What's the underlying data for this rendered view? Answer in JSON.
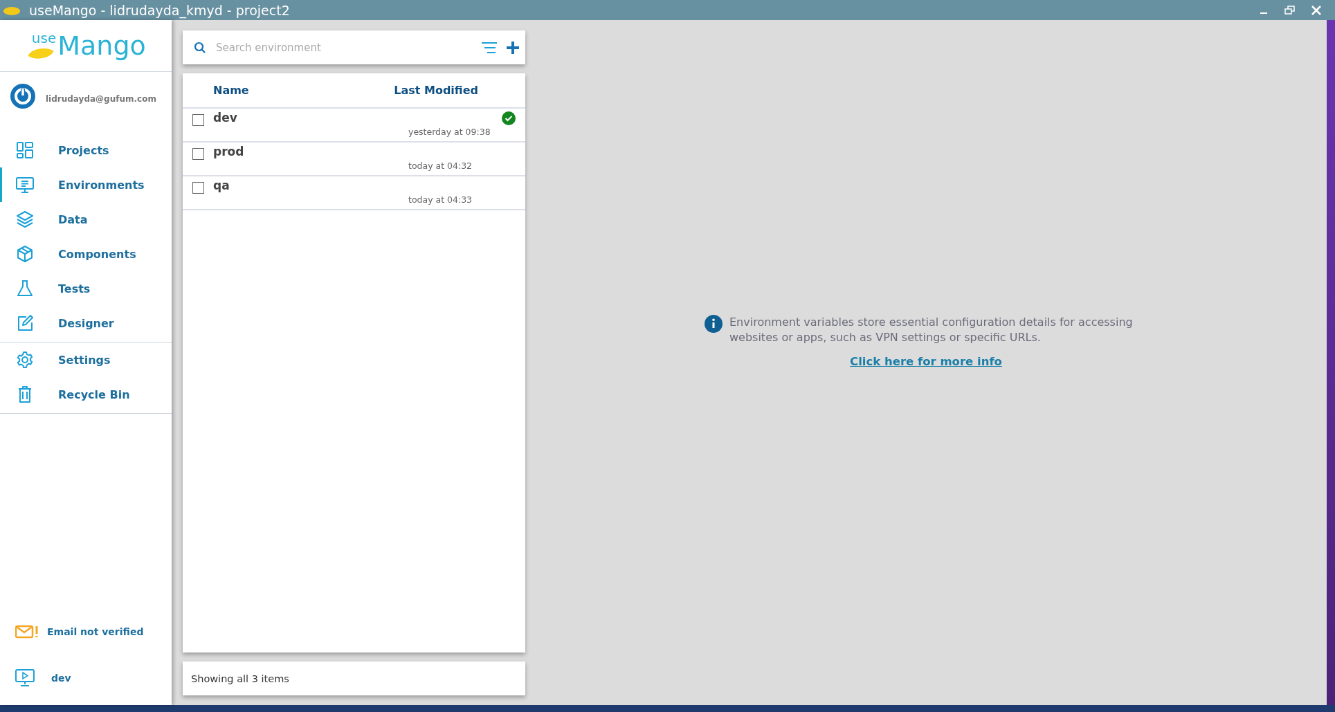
{
  "window": {
    "title": "useMango - lidrudayda_kmyd - project2"
  },
  "sidebar": {
    "logo": {
      "prefix": "use",
      "name": "Mango"
    },
    "user": {
      "email": "lidrudayda@gufum.com"
    },
    "nav_items": [
      {
        "label": "Projects",
        "kind": "projects",
        "selected": false
      },
      {
        "label": "Environments",
        "kind": "environments",
        "selected": true
      },
      {
        "label": "Data",
        "kind": "data",
        "selected": false
      },
      {
        "label": "Components",
        "kind": "components",
        "selected": false
      },
      {
        "label": "Tests",
        "kind": "tests",
        "selected": false
      },
      {
        "label": "Designer",
        "kind": "designer",
        "selected": false
      }
    ],
    "utility_items": [
      {
        "label": "Settings",
        "kind": "settings",
        "selected": false
      },
      {
        "label": "Recycle Bin",
        "kind": "recycle",
        "selected": false
      }
    ],
    "email_status": "Email not verified",
    "current_environment": "dev"
  },
  "search": {
    "placeholder": "Search environment"
  },
  "table": {
    "columns": [
      "Name",
      "Last Modified"
    ],
    "rows": [
      {
        "name": "dev",
        "modified": "yesterday at 09:38",
        "checked": false,
        "active": true
      },
      {
        "name": "prod",
        "modified": "today at 04:32",
        "checked": false,
        "active": false
      },
      {
        "name": "qa",
        "modified": "today at 04:33",
        "checked": false,
        "active": false
      }
    ]
  },
  "status_bar": "Showing all 3 items",
  "info": {
    "text": "Environment variables store essential configuration details for accessing websites or apps, such as VPN settings or specific URLs.",
    "link": "Click here for more info"
  }
}
